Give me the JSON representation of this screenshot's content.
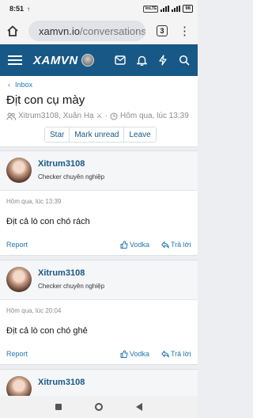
{
  "status": {
    "time": "8:51",
    "upload": "↑",
    "volte": "VoLTE",
    "battery": "98"
  },
  "browser": {
    "url_host": "xamvn.io",
    "url_path": "/conversations",
    "tab_count": "3"
  },
  "site": {
    "logo": "XAMVN"
  },
  "thread": {
    "breadcrumb": "Inbox",
    "title": "Địt con cụ mày",
    "participants": "Xitrum3108, Xuân Hạ",
    "separator": "·",
    "time": "Hôm qua, lúc 13:39",
    "actions": {
      "star": "Star",
      "mark_unread": "Mark unread",
      "leave": "Leave"
    }
  },
  "posts": [
    {
      "user": "Xitrum3108",
      "role": "Checker chuyên nghiệp",
      "time": "Hôm qua, lúc 13:39",
      "body": "Địt cả lò con chó rách",
      "report": "Report",
      "like": "Vodka",
      "reply": "Trả lời"
    },
    {
      "user": "Xitrum3108",
      "role": "Checker chuyên nghiệp",
      "time": "Hôm qua, lúc 20:04",
      "body": "Địt cả lò con chó ghẻ",
      "report": "Report",
      "like": "Vodka",
      "reply": "Trả lời"
    },
    {
      "user": "Xitrum3108"
    }
  ]
}
